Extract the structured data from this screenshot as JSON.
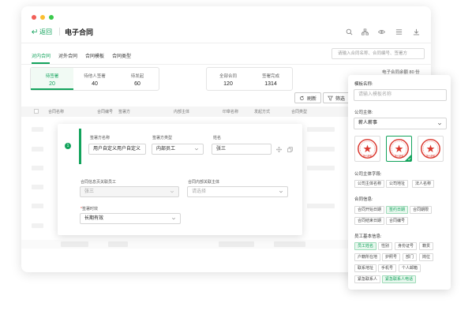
{
  "window": {
    "back_label": "返回",
    "title": "电子合同",
    "traffic_colors": [
      "#f25f58",
      "#fbbe2f",
      "#3bc94c"
    ]
  },
  "tabs": [
    "对内合同",
    "对外合同",
    "合同模板",
    "合同类型"
  ],
  "search": {
    "placeholder": "请输入合同名称、合同编号、签署方"
  },
  "stats_left": [
    {
      "label": "待签署",
      "value": "20"
    },
    {
      "label": "待他人签署",
      "value": "40"
    },
    {
      "label": "待发起",
      "value": "60"
    }
  ],
  "stats_right": [
    {
      "label": "全部合同",
      "value": "120"
    },
    {
      "label": "签署完成",
      "value": "1314"
    }
  ],
  "remaining": "电子合同余额 80 份",
  "toolbar": {
    "refresh": "刷新",
    "filter": "筛选"
  },
  "table_headers": [
    "合同名称",
    "合同编号",
    "签署方",
    "内部主体",
    "印章名称",
    "发起方式",
    "合同类型"
  ],
  "form": {
    "step": "1",
    "signer_name_label": "签署方名称",
    "signer_name_value": "用户自定义用户自定义",
    "signer_type_label": "签署方类型",
    "signer_type_value": "内部员工",
    "person_name_label": "姓名",
    "person_name_value": "张三",
    "related_emp_label": "合同信息页关联员工",
    "related_emp_value": "张三",
    "internal_subject_label": "合同内部关联主体",
    "internal_subject_placeholder": "请选择",
    "validity_label": "签署时效",
    "validity_value": "长期有效",
    "required_mark": "*"
  },
  "panel": {
    "template_name_label": "模板名称:",
    "template_name_placeholder": "请输入模板名称",
    "company_label": "公司主体:",
    "company_value": "薪人薪事",
    "seal_text": "薪人薪事",
    "company_fields_label": "公司主体字段:",
    "company_fields": [
      "公司主体名称",
      "公司地址",
      "法人名称"
    ],
    "contract_info_label": "合同信息:",
    "contract_info": [
      {
        "text": "合同开始日期",
        "on": false
      },
      {
        "text": "签约日期",
        "on": true
      },
      {
        "text": "合同期限",
        "on": false
      },
      {
        "text": "合同结束日期",
        "on": false
      },
      {
        "text": "合同编号",
        "on": false
      }
    ],
    "employee_label": "员工基本信息:",
    "employee_info": [
      {
        "text": "员工姓名",
        "on": true
      },
      {
        "text": "性别",
        "on": false
      },
      {
        "text": "身份证号",
        "on": false
      },
      {
        "text": "籍贯",
        "on": false
      },
      {
        "text": "户籍所在地",
        "on": false
      },
      {
        "text": "护照号",
        "on": false
      },
      {
        "text": "部门",
        "on": false
      },
      {
        "text": "岗位",
        "on": false
      },
      {
        "text": "联系地址",
        "on": false
      },
      {
        "text": "手机号",
        "on": false
      },
      {
        "text": "个人邮箱",
        "on": false
      },
      {
        "text": "紧急联系人",
        "on": false
      },
      {
        "text": "紧急联系人电话",
        "on": true
      }
    ]
  },
  "colors": {
    "accent": "#13a35c",
    "seal_red": "#d9342b"
  }
}
